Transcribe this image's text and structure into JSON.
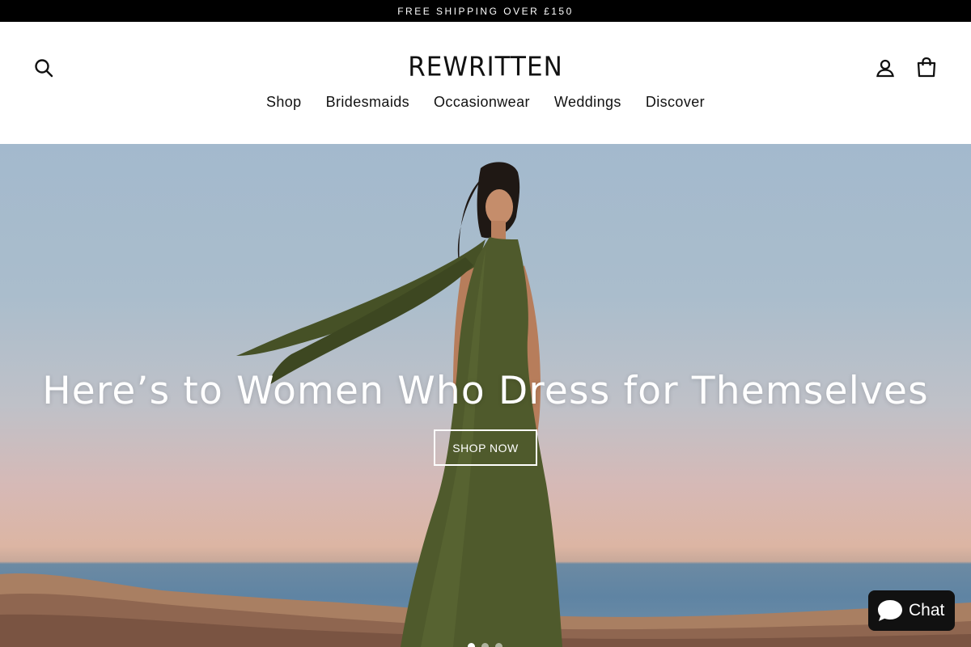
{
  "announcement": {
    "text": "FREE SHIPPING OVER £150"
  },
  "header": {
    "logo": "REWRITTEN",
    "icons": {
      "search": "search-icon",
      "account": "user-icon",
      "cart": "bag-icon"
    }
  },
  "nav": {
    "items": [
      {
        "label": "Shop"
      },
      {
        "label": "Bridesmaids"
      },
      {
        "label": "Occasionwear"
      },
      {
        "label": "Weddings"
      },
      {
        "label": "Discover"
      }
    ]
  },
  "hero": {
    "title": "Here’s to Women Who Dress for Themselves",
    "cta": "SHOP NOW",
    "slides": {
      "count": 3,
      "active": 1
    }
  },
  "chat": {
    "label": "Chat",
    "icon": "chat-bubble-icon"
  },
  "colors": {
    "announcement_bg": "#000000",
    "dress": "#4f5a2c",
    "chat_bg": "#111111"
  }
}
